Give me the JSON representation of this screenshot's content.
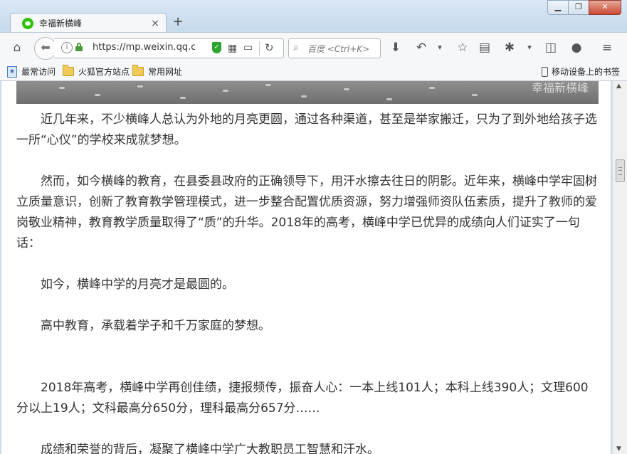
{
  "window": {
    "minimize_label": "▭",
    "restore_label": "❐",
    "close_label": "✕"
  },
  "tab": {
    "title": "幸福新横峰",
    "close_label": "×",
    "new_tab_label": "+"
  },
  "navbar": {
    "url": "https://mp.weixin.qq.com",
    "search_placeholder": "百度 <Ctrl+K>"
  },
  "bookmarks": {
    "items": [
      {
        "label": "最常访问"
      },
      {
        "label": "火狐官方站点"
      },
      {
        "label": "常用网址"
      }
    ],
    "mobile_label": "移动设备上的书签"
  },
  "hero": {
    "watermark": "幸福新横峰"
  },
  "article": {
    "paragraphs": [
      "近几年来，不少横峰人总认为外地的月亮更圆，通过各种渠道，甚至是举家搬迁，只为了到外地给孩子选一所“心仪”的学校来成就梦想。",
      "然而，如今横峰的教育，在县委县政府的正确领导下，用汗水擦去往日的阴影。近年来，横峰中学牢固树立质量意识，创新了教育教学管理模式，进一步整合配置优质资源，努力增强师资队伍素质，提升了教师的爱岗敬业精神，教育教学质量取得了“质”的升华。2018年的高考，横峰中学已优异的成绩向人们证实了一句话：",
      "如今，横峰中学的月亮才是最圆的。",
      "高中教育，承载着学子和千万家庭的梦想。",
      "2018年高考，横峰中学再创佳绩，捷报频传，振奋人心：一本上线101人；本科上线390人；文理600分以上19人；文科最高分650分，理科最高分657分……",
      "成绩和荣誉的背后，凝聚了横峰中学广大教职员工智慧和汗水。"
    ]
  }
}
